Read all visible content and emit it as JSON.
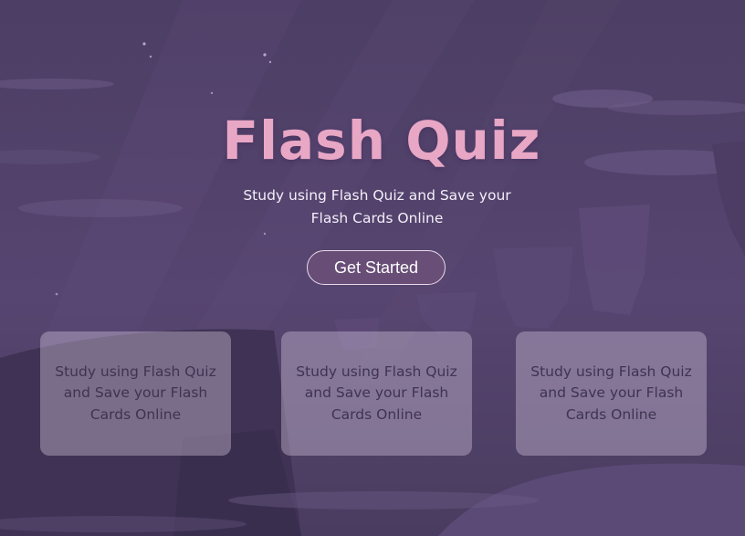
{
  "hero": {
    "title": "Flash Quiz",
    "subtitle": "Study using Flash Quiz and Save your Flash Cards Online",
    "cta_label": "Get Started"
  },
  "cards": [
    {
      "text": "Study using Flash Quiz and Save your Flash Cards Online"
    },
    {
      "text": "Study using Flash Quiz and Save your Flash Cards Online"
    },
    {
      "text": "Study using Flash Quiz and Save your Flash Cards Online"
    }
  ],
  "colors": {
    "background": "#4f4066",
    "title": "#e8a7c5",
    "subtitle": "#f4eefa",
    "card_text": "#3e3450"
  }
}
